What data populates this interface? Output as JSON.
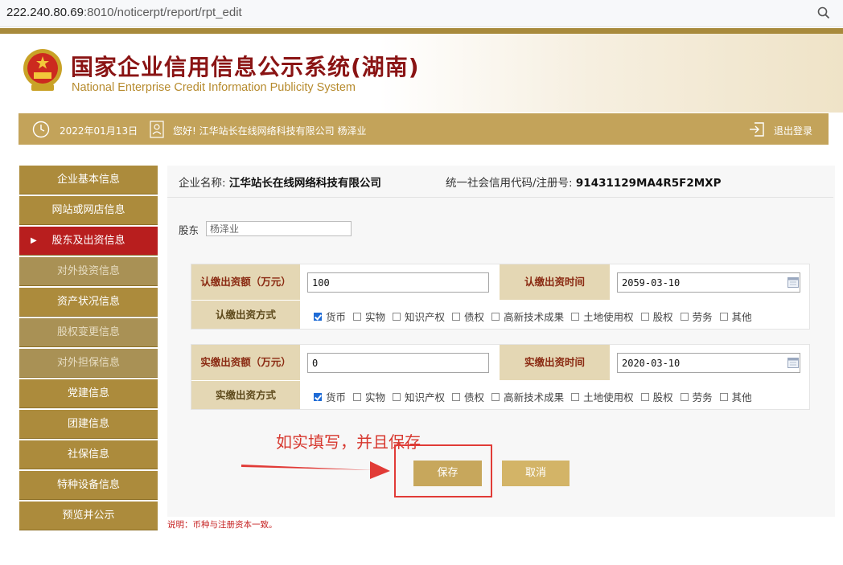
{
  "address_bar": {
    "host": "222.240.80.69",
    "rest": ":8010/noticerpt/report/rpt_edit"
  },
  "header": {
    "title_cn": "国家企业信用信息公示系统(湖南)",
    "title_en": "National Enterprise Credit Information Publicity System"
  },
  "infobar": {
    "date": "2022年01月13日",
    "greeting": "您好! 江华站长在线网络科技有限公司  杨泽业",
    "logout": "退出登录"
  },
  "sidebar": {
    "items": [
      {
        "label": "企业基本信息"
      },
      {
        "label": "网站或网店信息"
      },
      {
        "label": "股东及出资信息"
      },
      {
        "label": "对外投资信息"
      },
      {
        "label": "资产状况信息"
      },
      {
        "label": "股权变更信息"
      },
      {
        "label": "对外担保信息"
      },
      {
        "label": "党建信息"
      },
      {
        "label": "团建信息"
      },
      {
        "label": "社保信息"
      },
      {
        "label": "特种设备信息"
      },
      {
        "label": "预览并公示"
      }
    ]
  },
  "main": {
    "company_label": "企业名称:",
    "company_name": "江华站长在线网络科技有限公司",
    "credit_label": "统一社会信用代码/注册号:",
    "credit_code": "91431129MA4R5F2MXP",
    "holder_label": "股东",
    "holder_value": "杨泽业",
    "subscribed": {
      "amount_label": "认缴出资额（万元）",
      "amount_value": "100",
      "date_label": "认缴出资时间",
      "date_value": "2059-03-10",
      "method_label": "认缴出资方式"
    },
    "paid": {
      "amount_label": "实缴出资额（万元）",
      "amount_value": "0",
      "date_label": "实缴出资时间",
      "date_value": "2020-03-10",
      "method_label": "实缴出资方式"
    },
    "methods": [
      "货币",
      "实物",
      "知识产权",
      "债权",
      "高新技术成果",
      "土地使用权",
      "股权",
      "劳务",
      "其他"
    ],
    "save_label": "保存",
    "cancel_label": "取消",
    "note": "说明：币种与注册资本一致。"
  },
  "annotation": {
    "text": "如实填写，并且保存"
  },
  "colors": {
    "gold": "#ac8b3c",
    "active_red": "#b81e1e",
    "accent_red": "#d7382f"
  }
}
